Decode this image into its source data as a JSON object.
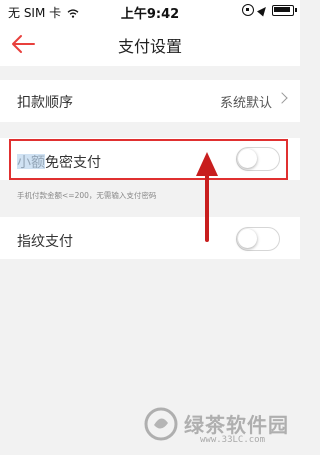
{
  "status_bar": {
    "carrier": "无 SIM 卡",
    "time": "上午9:42",
    "icons": [
      "wifi-icon",
      "orientation-lock-icon",
      "location-icon",
      "battery-icon"
    ]
  },
  "nav": {
    "title": "支付设置",
    "back_icon": "back-arrow-icon"
  },
  "settings": {
    "deduction_order": {
      "label": "扣款顺序",
      "value": "系统默认"
    },
    "small_amount": {
      "label": "小额免密支付",
      "enabled": false,
      "hint": "手机付款金额<=200，无需输入支付密码"
    },
    "fingerprint": {
      "label": "指纹支付",
      "enabled": false
    }
  },
  "annotation": {
    "highlight_color": "#e03030"
  },
  "colors": {
    "accent": "#e8403c",
    "background": "#f2f2f2"
  },
  "watermark": {
    "text": "绿茶软件园",
    "url": "www.33LC.com"
  }
}
